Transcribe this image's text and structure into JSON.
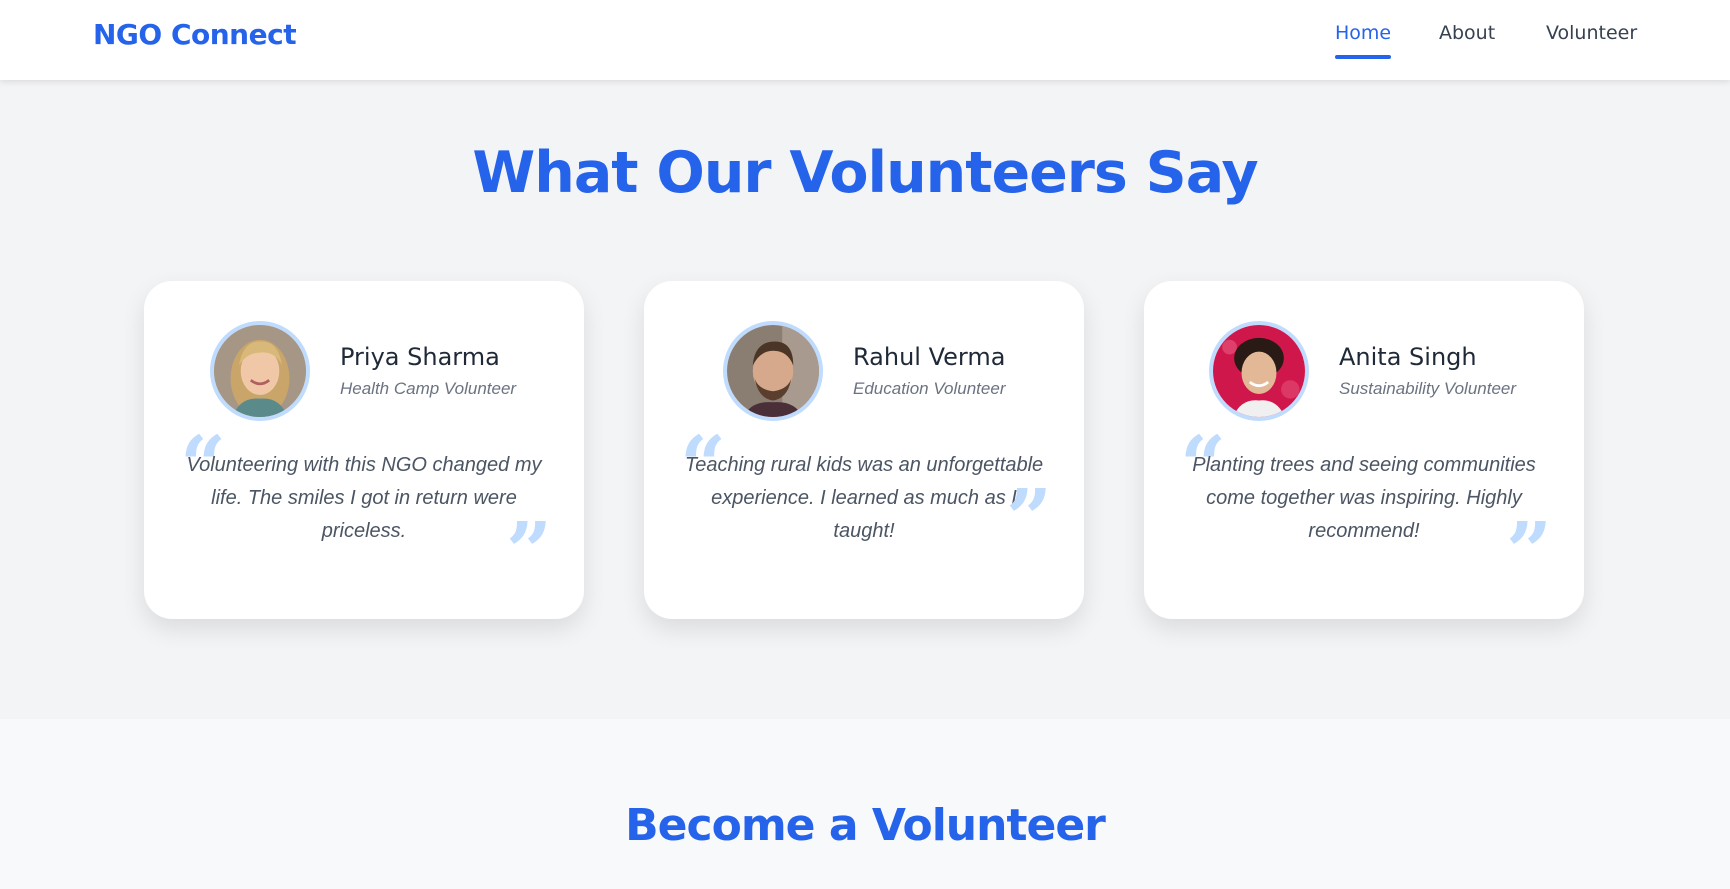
{
  "nav": {
    "brand": "NGO Connect",
    "links": [
      {
        "label": "Home",
        "active": true
      },
      {
        "label": "About",
        "active": false
      },
      {
        "label": "Volunteer",
        "active": false
      }
    ]
  },
  "testimonials": {
    "title": "What Our Volunteers Say",
    "cards": [
      {
        "name": "Priya Sharma",
        "role": "Health Camp Volunteer",
        "quote": "Volunteering with this NGO changed my life. The smiles I got in return were priceless."
      },
      {
        "name": "Rahul Verma",
        "role": "Education Volunteer",
        "quote": "Teaching rural kids was an unforgettable experience. I learned as much as I taught!"
      },
      {
        "name": "Anita Singh",
        "role": "Sustainability Volunteer",
        "quote": "Planting trees and seeing communities come together was inspiring. Highly recommend!"
      }
    ]
  },
  "volunteer_section": {
    "title": "Become a Volunteer"
  },
  "colors": {
    "primary": "#2563eb",
    "quote_mark": "#bfdbfe",
    "page_bg": "#f3f4f6"
  }
}
